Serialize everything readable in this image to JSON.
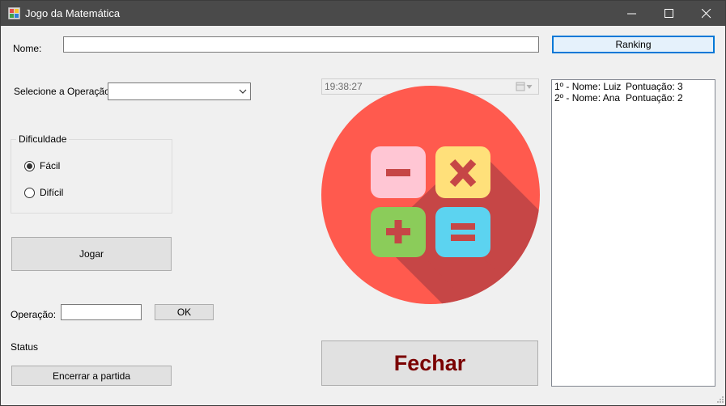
{
  "window": {
    "title": "Jogo da Matemática"
  },
  "form": {
    "nome_label": "Nome:",
    "nome_value": "",
    "ranking_button": "Ranking",
    "operacao_select_label": "Selecione a Operação",
    "operacao_select_value": "",
    "time": "19:38:27",
    "dificuldade": {
      "title": "Dificuldade",
      "options": [
        {
          "label": "Fácil",
          "selected": true
        },
        {
          "label": "Difícil",
          "selected": false
        }
      ]
    },
    "jogar_button": "Jogar",
    "operacao_label": "Operação:",
    "operacao_value": "",
    "ok_button": "OK",
    "status_label": "Status",
    "encerrar_button": "Encerrar a partida",
    "fechar_button": "Fechar"
  },
  "ranking": [
    {
      "pos": "1º  - Nome: Luiz",
      "score": "Pontuação: 3"
    },
    {
      "pos": "2º  - Nome: Ana",
      "score": "Pontuação: 2"
    }
  ],
  "logo": {
    "icon": "calculator-icon",
    "colors": {
      "circle": "#ff5a4e",
      "shadow": "#c64646",
      "minus": "#ffc6d4",
      "times": "#ffe07a",
      "plus": "#8bcc5a",
      "equals": "#5cd3f0",
      "symbol": "#c64646"
    }
  }
}
